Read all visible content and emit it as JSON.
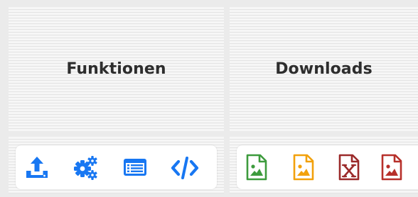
{
  "columns": {
    "functions": {
      "title": "Funktionen"
    },
    "downloads": {
      "title": "Downloads"
    }
  },
  "colors": {
    "functions_blue": "#1877f2",
    "download_png_green": "#3d9b3d",
    "download_jpg_orange": "#f2a10c",
    "download_xls_maroon": "#9b2a2a",
    "download_image_red": "#b7302a"
  },
  "function_buttons": [
    {
      "icon": "upload-icon"
    },
    {
      "icon": "gears-icon"
    },
    {
      "icon": "list-window-icon"
    },
    {
      "icon": "code-icon"
    }
  ],
  "download_buttons": [
    {
      "icon": "image-file-green-icon"
    },
    {
      "icon": "image-file-orange-icon"
    },
    {
      "icon": "excel-file-icon"
    },
    {
      "icon": "image-file-red-icon"
    }
  ]
}
